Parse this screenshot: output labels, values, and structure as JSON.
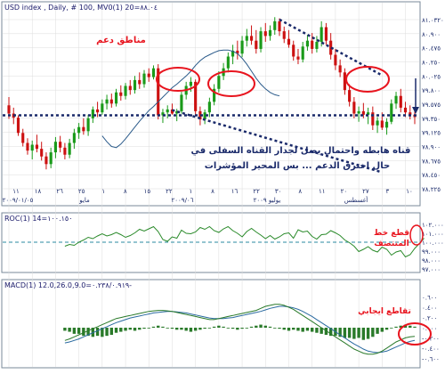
{
  "colors": {
    "up": "#1a9a1a",
    "down": "#cc1111",
    "ma": "#2a5a8a",
    "roc": "#2a8a2a",
    "macd_hist": "#2a7a2a",
    "macd_line": "#2a7a2a",
    "macd_signal": "#2a6aa0",
    "support": "#1a2a6a",
    "channel": "#1a2a6a",
    "annotation_red": "#e8141e",
    "annotation_navy": "#1a2a6a",
    "axis_text": "#1a2a6a",
    "panel_title": "#1a1a6a",
    "grid": "#dcdcdc",
    "frame": "#7a8a9a"
  },
  "panels": {
    "price_title": "USD index , Daily, # 100, MV0(1) 20=٨٨.٠٤",
    "roc_title": "ROC(1) 14=١٠٠.١٥٠",
    "macd_title": "MACD(1) 12.0,26.0,9.0=٠.٢٣٨/٠.٩١٩-"
  },
  "annotations": {
    "support_zone": "مناطق دعم",
    "channel_text_line1": "قناه هابطه واحتمال يصل لجدار القناه السفلى في",
    "channel_text_line2": "حال اخترق الدعم ... بس المحير المؤشرات",
    "roc_note_line1": "قطع خط",
    "roc_note_line2": "المنتصف",
    "macd_note": "تقاطع ايجابي"
  },
  "chart_data": [
    {
      "type": "candlestick",
      "title": "USD index , Daily, # 100, MV0(1) 20=٨٨.٠٤",
      "x_tick_labels": [
        "١١",
        "١٨",
        "٢٦",
        "٢٥",
        "١",
        "٨",
        "١٥",
        "٢٢",
        "١",
        "٨",
        "١٦",
        "٢٢",
        "٣٠",
        "٨",
        "١١",
        "٢٠",
        "٢٧",
        "٣",
        "١٠"
      ],
      "x_group_labels": [
        "٢٠٠٩/٠١/٠٥",
        "مايو",
        "٢٠٠٩/٠٦",
        "يوليو ٢٠٠٩",
        "أغسطس"
      ],
      "y_tick_labels": [
        "٨١.٠٣٢٠",
        "٨٠.٩٠٠",
        "٨٠.٤٧٥",
        "٨٠.٢٥٠",
        "٨٠.٠٢٥",
        "٧٩.٨٠٠",
        "٧٩.٥٧٥",
        "٧٩.٣٥٠",
        "٧٩.١٢٥",
        "٧٨.٩٠٠",
        "٧٨.٦٧٥",
        "٧٨.٤٥٠",
        "٧٨.٢٢٥"
      ],
      "ylim": [
        78.1,
        81.1
      ],
      "support_level": 79.35,
      "channel_upper": [
        [
          58,
          80.98
        ],
        [
          80,
          80.03
        ]
      ],
      "channel_lower": [
        [
          35,
          79.44
        ],
        [
          80,
          78.38
        ]
      ],
      "ohlc": [
        [
          79.52,
          79.66,
          79.29,
          79.38
        ],
        [
          79.38,
          79.48,
          79.2,
          79.31
        ],
        [
          79.31,
          79.35,
          79.0,
          79.05
        ],
        [
          79.05,
          79.12,
          78.82,
          78.88
        ],
        [
          78.88,
          78.96,
          78.68,
          78.75
        ],
        [
          78.75,
          78.92,
          78.6,
          78.85
        ],
        [
          78.85,
          79.02,
          78.72,
          78.78
        ],
        [
          78.78,
          78.9,
          78.58,
          78.65
        ],
        [
          78.65,
          78.72,
          78.43,
          78.52
        ],
        [
          78.52,
          78.8,
          78.45,
          78.72
        ],
        [
          78.72,
          78.98,
          78.62,
          78.9
        ],
        [
          78.9,
          79.0,
          78.72,
          78.8
        ],
        [
          78.8,
          78.88,
          78.6,
          78.68
        ],
        [
          78.68,
          78.95,
          78.62,
          78.88
        ],
        [
          78.88,
          79.12,
          78.78,
          79.05
        ],
        [
          79.05,
          79.22,
          78.95,
          79.15
        ],
        [
          79.15,
          79.3,
          79.02,
          79.08
        ],
        [
          79.08,
          79.36,
          79.0,
          79.3
        ],
        [
          79.3,
          79.5,
          79.22,
          79.45
        ],
        [
          79.45,
          79.58,
          79.32,
          79.4
        ],
        [
          79.4,
          79.62,
          79.36,
          79.55
        ],
        [
          79.55,
          79.7,
          79.45,
          79.62
        ],
        [
          79.62,
          79.72,
          79.48,
          79.55
        ],
        [
          79.55,
          79.8,
          79.5,
          79.74
        ],
        [
          79.74,
          79.86,
          79.6,
          79.68
        ],
        [
          79.68,
          79.9,
          79.62,
          79.85
        ],
        [
          79.85,
          79.95,
          79.7,
          79.78
        ],
        [
          79.78,
          80.02,
          79.72,
          79.95
        ],
        [
          79.95,
          80.08,
          79.8,
          79.88
        ],
        [
          79.88,
          80.12,
          79.82,
          80.06
        ],
        [
          80.06,
          80.15,
          79.92,
          80.0
        ],
        [
          80.0,
          80.2,
          79.96,
          80.15
        ],
        [
          80.15,
          80.22,
          79.28,
          79.35
        ],
        [
          79.35,
          79.46,
          79.22,
          79.4
        ],
        [
          79.4,
          79.52,
          79.3,
          79.45
        ],
        [
          79.45,
          79.55,
          79.36,
          79.38
        ],
        [
          79.38,
          79.46,
          79.25,
          79.42
        ],
        [
          79.42,
          79.75,
          79.38,
          79.7
        ],
        [
          79.7,
          79.92,
          79.62,
          79.85
        ],
        [
          79.85,
          80.0,
          79.75,
          79.92
        ],
        [
          79.92,
          79.96,
          79.35,
          79.42
        ],
        [
          79.42,
          79.5,
          79.18,
          79.28
        ],
        [
          79.28,
          79.45,
          79.2,
          79.4
        ],
        [
          79.4,
          79.65,
          79.32,
          79.58
        ],
        [
          79.58,
          79.88,
          79.52,
          79.8
        ],
        [
          79.8,
          80.1,
          79.74,
          80.02
        ],
        [
          80.02,
          80.24,
          79.95,
          80.15
        ],
        [
          80.15,
          80.42,
          80.08,
          80.35
        ],
        [
          80.35,
          80.55,
          80.22,
          80.45
        ],
        [
          80.45,
          80.62,
          80.3,
          80.4
        ],
        [
          80.4,
          80.7,
          80.34,
          80.62
        ],
        [
          80.62,
          80.82,
          80.52,
          80.7
        ],
        [
          80.7,
          80.88,
          80.55,
          80.62
        ],
        [
          80.62,
          80.8,
          80.4,
          80.48
        ],
        [
          80.48,
          80.85,
          80.42,
          80.78
        ],
        [
          80.78,
          80.92,
          80.6,
          80.7
        ],
        [
          80.7,
          80.88,
          80.62,
          80.8
        ],
        [
          80.8,
          81.02,
          80.72,
          80.95
        ],
        [
          80.95,
          81.0,
          80.7,
          80.78
        ],
        [
          80.78,
          80.86,
          80.58,
          80.65
        ],
        [
          80.65,
          80.8,
          80.5,
          80.55
        ],
        [
          80.55,
          80.62,
          80.28,
          80.35
        ],
        [
          80.35,
          80.48,
          80.22,
          80.3
        ],
        [
          80.3,
          80.6,
          80.25,
          80.52
        ],
        [
          80.52,
          80.72,
          80.45,
          80.62
        ],
        [
          80.62,
          80.75,
          80.4,
          80.48
        ],
        [
          80.48,
          80.7,
          80.42,
          80.6
        ],
        [
          80.6,
          80.95,
          80.52,
          80.85
        ],
        [
          80.85,
          80.92,
          80.55,
          80.62
        ],
        [
          80.62,
          80.75,
          80.3,
          80.38
        ],
        [
          80.38,
          80.48,
          80.12,
          80.2
        ],
        [
          80.2,
          80.3,
          80.0,
          80.08
        ],
        [
          80.08,
          80.15,
          79.7,
          79.78
        ],
        [
          79.78,
          79.88,
          79.5,
          79.58
        ],
        [
          79.58,
          79.66,
          79.3,
          79.38
        ],
        [
          79.38,
          79.5,
          79.24,
          79.42
        ],
        [
          79.42,
          79.56,
          79.3,
          79.36
        ],
        [
          79.36,
          79.48,
          79.2,
          79.4
        ],
        [
          79.4,
          79.5,
          79.1,
          79.18
        ],
        [
          79.18,
          79.32,
          79.05,
          79.26
        ],
        [
          79.26,
          79.4,
          79.1,
          79.14
        ],
        [
          79.14,
          79.3,
          79.02,
          79.24
        ],
        [
          79.24,
          79.62,
          79.2,
          79.55
        ],
        [
          79.55,
          79.75,
          79.46,
          79.68
        ],
        [
          79.68,
          79.8,
          79.4,
          79.48
        ],
        [
          79.48,
          79.58,
          79.32,
          79.4
        ],
        [
          79.4,
          79.52,
          79.28,
          79.36
        ],
        [
          79.36,
          79.46,
          79.2,
          79.32
        ]
      ],
      "ma20": [
        79.0,
        78.9,
        78.82,
        78.8,
        78.86,
        78.95,
        79.05,
        79.15,
        79.25,
        79.34,
        79.43,
        79.5,
        79.58,
        79.66,
        79.74,
        79.82,
        79.88,
        79.95,
        80.02,
        80.1,
        80.2,
        80.28,
        80.34,
        80.38,
        80.42,
        80.45,
        80.46,
        80.46,
        80.44,
        80.4,
        80.32,
        80.22,
        80.1,
        79.98,
        79.88,
        79.8,
        79.74,
        79.7,
        79.68
      ],
      "ma20_start_index": 20
    },
    {
      "type": "line",
      "title": "ROC(1) 14=١٠٠.١٥٠",
      "y_tick_labels": [
        "١٠٢.٠٠٠",
        "١٠١.٠٠٠",
        "١٠٠.٠٠٠",
        "٩٩.٠٠٠",
        "٩٨.٠٠٠",
        "٩٧.٠٠٠"
      ],
      "ylim": [
        97.0,
        102.0
      ],
      "midline": 100.0,
      "start_index": 12,
      "values": [
        99.55,
        99.75,
        99.65,
        100.0,
        100.25,
        100.55,
        100.4,
        100.7,
        100.95,
        100.7,
        100.85,
        101.1,
        100.85,
        100.55,
        100.75,
        101.05,
        101.45,
        101.25,
        101.5,
        101.75,
        101.2,
        100.3,
        100.1,
        100.6,
        100.45,
        101.35,
        101.0,
        100.95,
        101.15,
        101.65,
        101.45,
        101.75,
        101.3,
        101.1,
        101.5,
        101.75,
        101.3,
        101.0,
        100.6,
        101.2,
        101.55,
        101.15,
        100.8,
        100.4,
        100.75,
        100.35,
        100.6,
        100.95,
        101.05,
        100.45,
        101.4,
        101.15,
        101.25,
        100.65,
        100.35,
        100.85,
        100.9,
        101.3,
        101.05,
        100.75,
        100.25,
        99.95,
        99.55,
        98.95,
        99.2,
        99.5,
        99.1,
        98.9,
        99.45,
        99.2,
        98.55,
        98.9,
        99.05,
        98.35,
        98.6,
        99.3,
        99.85,
        100.45
      ]
    },
    {
      "type": "bar",
      "title": "MACD(1) 12.0,26.0,9.0=٠.٢٣٨/٠.٩١٩-",
      "y_tick_labels": [
        "٠.٦٠٠",
        "٠.٤٠٠",
        "٠.٢٠٠",
        "٠.٠٠٠",
        "-٠.٢٠٠",
        "-٠.٤٠٠",
        "-٠.٦٠٠"
      ],
      "ylim": [
        -0.7,
        0.7
      ],
      "start_index": 12,
      "histogram": [
        -0.06,
        -0.08,
        -0.12,
        -0.12,
        -0.16,
        -0.16,
        -0.18,
        -0.16,
        -0.18,
        -0.16,
        -0.14,
        -0.1,
        -0.08,
        -0.06,
        -0.04,
        -0.06,
        -0.04,
        -0.02,
        0.0,
        0.02,
        0.04,
        0.02,
        0.0,
        -0.02,
        -0.04,
        -0.04,
        -0.06,
        -0.08,
        -0.06,
        -0.04,
        -0.02,
        0.0,
        0.02,
        0.04,
        0.02,
        0.0,
        -0.02,
        -0.04,
        -0.02,
        0.0,
        0.02,
        0.04,
        0.06,
        0.04,
        0.02,
        0.0,
        -0.02,
        -0.04,
        -0.06,
        -0.04,
        -0.06,
        -0.08,
        -0.06,
        -0.08,
        -0.1,
        -0.12,
        -0.14,
        -0.16,
        -0.16,
        -0.18,
        -0.2,
        -0.2,
        -0.22,
        -0.2,
        -0.24,
        -0.22,
        -0.18,
        -0.12,
        -0.08,
        -0.04,
        0.0,
        0.02,
        0.04,
        0.06,
        0.04,
        0.02
      ],
      "macd": [
        -0.25,
        -0.22,
        -0.18,
        -0.14,
        -0.1,
        -0.06,
        -0.02,
        0.02,
        0.06,
        0.1,
        0.14,
        0.18,
        0.2,
        0.22,
        0.24,
        0.26,
        0.28,
        0.3,
        0.32,
        0.33,
        0.34,
        0.34,
        0.33,
        0.32,
        0.3,
        0.28,
        0.26,
        0.24,
        0.22,
        0.2,
        0.18,
        0.16,
        0.16,
        0.18,
        0.2,
        0.22,
        0.24,
        0.26,
        0.28,
        0.3,
        0.32,
        0.34,
        0.38,
        0.42,
        0.44,
        0.46,
        0.46,
        0.44,
        0.4,
        0.36,
        0.3,
        0.24,
        0.18,
        0.12,
        0.06,
        0.0,
        -0.06,
        -0.12,
        -0.18,
        -0.24,
        -0.3,
        -0.36,
        -0.42,
        -0.46,
        -0.5,
        -0.52,
        -0.52,
        -0.5,
        -0.46,
        -0.4,
        -0.34,
        -0.28,
        -0.24,
        -0.2,
        -0.18,
        -0.17
      ],
      "signal": [
        -0.3,
        -0.28,
        -0.25,
        -0.22,
        -0.18,
        -0.14,
        -0.1,
        -0.06,
        -0.02,
        0.02,
        0.06,
        0.1,
        0.13,
        0.16,
        0.19,
        0.21,
        0.23,
        0.25,
        0.27,
        0.29,
        0.3,
        0.31,
        0.32,
        0.32,
        0.31,
        0.3,
        0.29,
        0.27,
        0.25,
        0.23,
        0.21,
        0.19,
        0.18,
        0.18,
        0.18,
        0.19,
        0.2,
        0.22,
        0.24,
        0.26,
        0.28,
        0.3,
        0.32,
        0.35,
        0.38,
        0.4,
        0.42,
        0.42,
        0.41,
        0.39,
        0.36,
        0.32,
        0.27,
        0.22,
        0.16,
        0.1,
        0.04,
        -0.02,
        -0.08,
        -0.14,
        -0.2,
        -0.26,
        -0.32,
        -0.37,
        -0.42,
        -0.46,
        -0.48,
        -0.49,
        -0.48,
        -0.46,
        -0.42,
        -0.38,
        -0.34,
        -0.3,
        -0.27,
        -0.25
      ]
    }
  ]
}
